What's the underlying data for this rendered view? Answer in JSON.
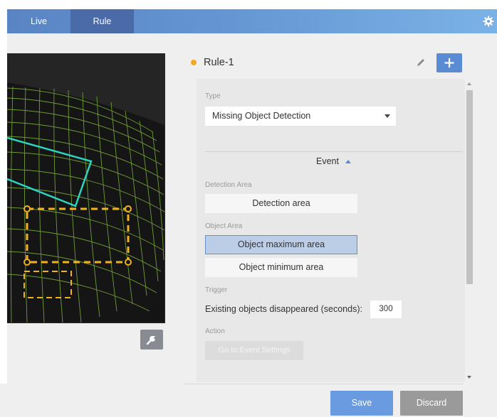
{
  "tabs": [
    {
      "label": "Live",
      "active": false
    },
    {
      "label": "Rule",
      "active": true
    }
  ],
  "header": {
    "settings_icon": "gear-icon"
  },
  "camera": {
    "tool_icon": "wrench-icon"
  },
  "rule": {
    "name": "Rule-1",
    "status_color": "#f2a81f",
    "edit_icon": "pencil-icon",
    "add_label": "+"
  },
  "type": {
    "label": "Type",
    "selected": "Missing Object Detection"
  },
  "event": {
    "label": "Event",
    "detection_area_label": "Detection Area",
    "detection_area_button": "Detection area",
    "object_area_label": "Object Area",
    "object_max_button": "Object maximum area",
    "object_min_button": "Object minimum area",
    "trigger_label": "Trigger",
    "trigger_text": "Existing objects disappeared (seconds):",
    "trigger_value": "300",
    "action_label": "Action",
    "action_button": "Go to Event Settings"
  },
  "footer": {
    "save": "Save",
    "discard": "Discard"
  },
  "colors": {
    "accent": "#5b8cd3",
    "detection_outline": "#2dd4bf",
    "object_box": "#f2b21b",
    "grid": "#7fb43a"
  }
}
